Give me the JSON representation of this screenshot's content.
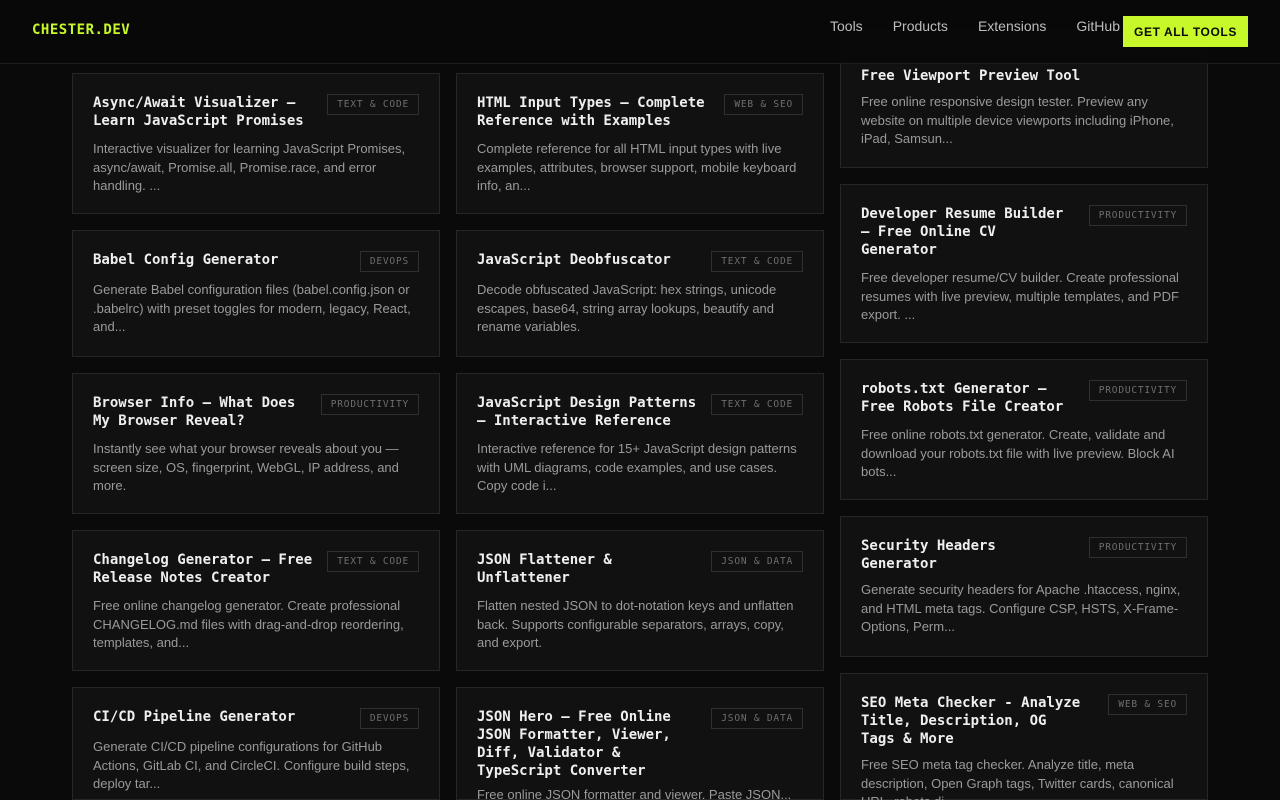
{
  "header": {
    "logo": "CHESTER.DEV",
    "nav": [
      "Tools",
      "Products",
      "Extensions",
      "GitHub"
    ],
    "cta": "GET ALL TOOLS"
  },
  "cards": [
    {
      "title": "Async/Await Visualizer — Learn JavaScript Promises",
      "badge": "TEXT & CODE",
      "desc": "Interactive visualizer for learning JavaScript Promises, async/await, Promise.all, Promise.race, and error handling. ..."
    },
    {
      "title": "HTML Input Types — Complete Reference with Examples",
      "badge": "WEB & SEO",
      "desc": "Complete reference for all HTML input types with live examples, attributes, browser support, mobile keyboard info, an..."
    },
    {
      "title": "Free Viewport Preview Tool",
      "badge": "",
      "desc": "Free online responsive design tester. Preview any website on multiple device viewports including iPhone, iPad, Samsun..."
    },
    {
      "title": "Babel Config Generator",
      "badge": "DEVOPS",
      "desc": "Generate Babel configuration files (babel.config.json or .babelrc) with preset toggles for modern, legacy, React, and..."
    },
    {
      "title": "JavaScript Deobfuscator",
      "badge": "TEXT & CODE",
      "desc": "Decode obfuscated JavaScript: hex strings, unicode escapes, base64, string array lookups, beautify and rename variables."
    },
    {
      "title": "Developer Resume Builder — Free Online CV Generator",
      "badge": "PRODUCTIVITY",
      "desc": "Free developer resume/CV builder. Create professional resumes with live preview, multiple templates, and PDF export. ..."
    },
    {
      "title": "Browser Info — What Does My Browser Reveal?",
      "badge": "PRODUCTIVITY",
      "desc": "Instantly see what your browser reveals about you — screen size, OS, fingerprint, WebGL, IP address, and more."
    },
    {
      "title": "JavaScript Design Patterns — Interactive Reference",
      "badge": "TEXT & CODE",
      "desc": "Interactive reference for 15+ JavaScript design patterns with UML diagrams, code examples, and use cases. Copy code i..."
    },
    {
      "title": "robots.txt Generator — Free Robots File Creator",
      "badge": "PRODUCTIVITY",
      "desc": "Free online robots.txt generator. Create, validate and download your robots.txt file with live preview. Block AI bots..."
    },
    {
      "title": "Changelog Generator — Free Release Notes Creator",
      "badge": "TEXT & CODE",
      "desc": "Free online changelog generator. Create professional CHANGELOG.md files with drag-and-drop reordering, templates, and..."
    },
    {
      "title": "JSON Flattener & Unflattener",
      "badge": "JSON & DATA",
      "desc": "Flatten nested JSON to dot-notation keys and unflatten back. Supports configurable separators, arrays, copy, and export."
    },
    {
      "title": "Security Headers Generator",
      "badge": "PRODUCTIVITY",
      "desc": "Generate security headers for Apache .htaccess, nginx, and HTML meta tags. Configure CSP, HSTS, X-Frame-Options, Perm..."
    },
    {
      "title": "CI/CD Pipeline Generator",
      "badge": "DEVOPS",
      "desc": "Generate CI/CD pipeline configurations for GitHub Actions, GitLab CI, and CircleCI. Configure build steps, deploy tar..."
    },
    {
      "title": "JSON Hero — Free Online JSON Formatter, Viewer, Diff, Validator & TypeScript Converter",
      "badge": "JSON & DATA",
      "desc": "Free online JSON formatter and viewer. Paste JSON..."
    },
    {
      "title": "SEO Meta Checker - Analyze Title, Description, OG Tags & More",
      "badge": "WEB & SEO",
      "desc": "Free SEO meta tag checker. Analyze title, meta description, Open Graph tags, Twitter cards, canonical URL, robots di..."
    }
  ]
}
